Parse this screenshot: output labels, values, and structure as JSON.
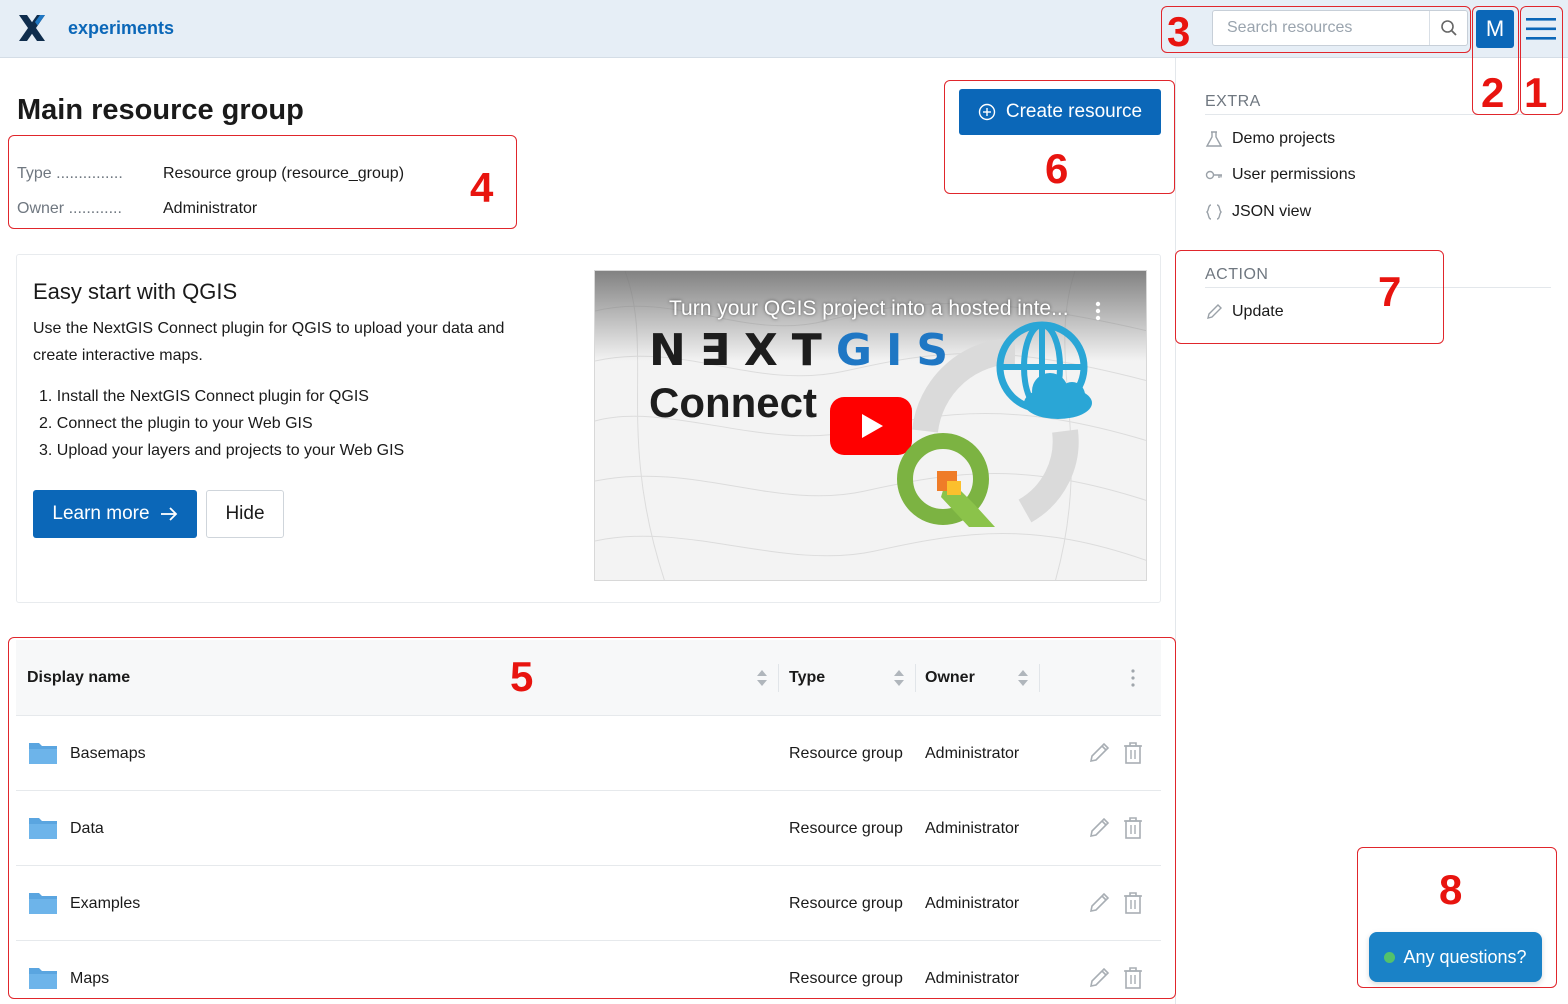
{
  "header": {
    "app_name": "experiments",
    "search_placeholder": "Search resources",
    "avatar_letter": "M"
  },
  "page": {
    "title": "Main resource group",
    "create_button": "Create resource",
    "properties": [
      {
        "label": "Type ...............",
        "value": "Resource group (resource_group)"
      },
      {
        "label": "Owner ............",
        "value": "Administrator"
      }
    ]
  },
  "promo": {
    "title": "Easy start with QGIS",
    "text": "Use the NextGIS Connect plugin for QGIS to upload your data and create interactive maps.",
    "steps": [
      "1.  Install the NextGIS Connect plugin for QGIS",
      "2.  Connect the plugin to your Web GIS",
      "3.  Upload your layers and projects to your Web GIS"
    ],
    "learn_more": "Learn more",
    "hide": "Hide",
    "video": {
      "title": "Turn your QGIS project into a hosted inte...",
      "brand_left": "N∃XT",
      "brand_right": "GIS",
      "subtitle": "Connect"
    }
  },
  "table": {
    "columns": [
      "Display name",
      "Type",
      "Owner"
    ],
    "rows": [
      {
        "name": "Basemaps",
        "type": "Resource group",
        "owner": "Administrator"
      },
      {
        "name": "Data",
        "type": "Resource group",
        "owner": "Administrator"
      },
      {
        "name": "Examples",
        "type": "Resource group",
        "owner": "Administrator"
      },
      {
        "name": "Maps",
        "type": "Resource group",
        "owner": "Administrator"
      }
    ]
  },
  "sidebar": {
    "extra_heading": "EXTRA",
    "extra_items": [
      "Demo projects",
      "User permissions",
      "JSON view"
    ],
    "action_heading": "ACTION",
    "action_items": [
      "Update"
    ]
  },
  "chat": {
    "label": "Any questions?"
  },
  "annotations": [
    "1",
    "2",
    "3",
    "4",
    "5",
    "6",
    "7",
    "8"
  ],
  "colors": {
    "brand": "#0b67b8",
    "header_bg": "#e6eef6",
    "annotation": "#e0262c",
    "folder": "#5aa5e0",
    "chat": "#1a82c7"
  },
  "icons": [
    "nextgis-logo-icon",
    "search-icon",
    "hamburger-menu-icon",
    "plus-circle-icon",
    "arrow-right-icon",
    "folder-icon",
    "pencil-icon",
    "trash-icon",
    "flask-icon",
    "key-icon",
    "braces-icon",
    "sort-icon",
    "kebab-icon",
    "youtube-play-icon",
    "globe-cloud-icon",
    "qgis-logo-icon"
  ]
}
